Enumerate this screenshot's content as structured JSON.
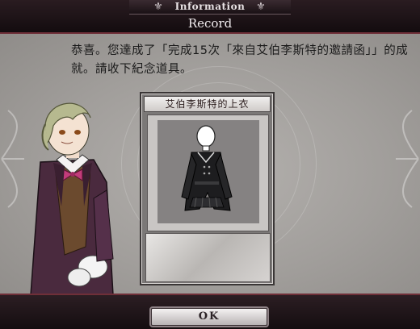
{
  "header": {
    "tab_title": "Information",
    "subtitle": "Record"
  },
  "message": {
    "text": "恭喜。您達成了「完成15次「來自艾伯李斯特的邀請函」」的成就。請收下紀念道具。"
  },
  "item_card": {
    "name": "艾伯李斯特的上衣"
  },
  "footer": {
    "ok_label": "OK"
  },
  "colors": {
    "header_bg": "#1c1316",
    "accent_rule": "#6f2f38",
    "panel_bg": "#a19e9b",
    "card_bg": "#7b7877"
  },
  "icons": [
    "fleur-ornament-icon",
    "ok-button"
  ]
}
